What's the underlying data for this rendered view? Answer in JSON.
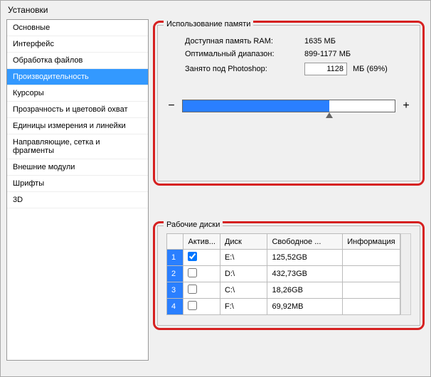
{
  "window": {
    "title": "Установки"
  },
  "sidebar": {
    "items": [
      {
        "label": "Основные"
      },
      {
        "label": "Интерфейс"
      },
      {
        "label": "Обработка файлов"
      },
      {
        "label": "Производительность"
      },
      {
        "label": "Курсоры"
      },
      {
        "label": "Прозрачность и цветовой охват"
      },
      {
        "label": "Единицы измерения и линейки"
      },
      {
        "label": "Направляющие, сетка и фрагменты"
      },
      {
        "label": "Внешние модули"
      },
      {
        "label": "Шрифты"
      },
      {
        "label": "3D"
      }
    ],
    "selectedIndex": 3
  },
  "memory": {
    "legend": "Использование памяти",
    "available_label": "Доступная память RAM:",
    "available_value": "1635 МБ",
    "optimal_label": "Оптимальный диапазон:",
    "optimal_value": "899-1177 МБ",
    "used_label": "Занято под Photoshop:",
    "used_value": "1128",
    "used_unit": "МБ (69%)",
    "minus": "−",
    "plus": "+"
  },
  "disks": {
    "legend": "Рабочие диски",
    "headers": {
      "active": "Актив...",
      "drive": "Диск",
      "free": "Свободное ...",
      "info": "Информация"
    },
    "rows": [
      {
        "num": "1",
        "active": true,
        "drive": "E:\\",
        "free": "125,52GB",
        "info": ""
      },
      {
        "num": "2",
        "active": false,
        "drive": "D:\\",
        "free": "432,73GB",
        "info": ""
      },
      {
        "num": "3",
        "active": false,
        "drive": "C:\\",
        "free": "18,26GB",
        "info": ""
      },
      {
        "num": "4",
        "active": false,
        "drive": "F:\\",
        "free": "69,92MB",
        "info": ""
      }
    ]
  }
}
